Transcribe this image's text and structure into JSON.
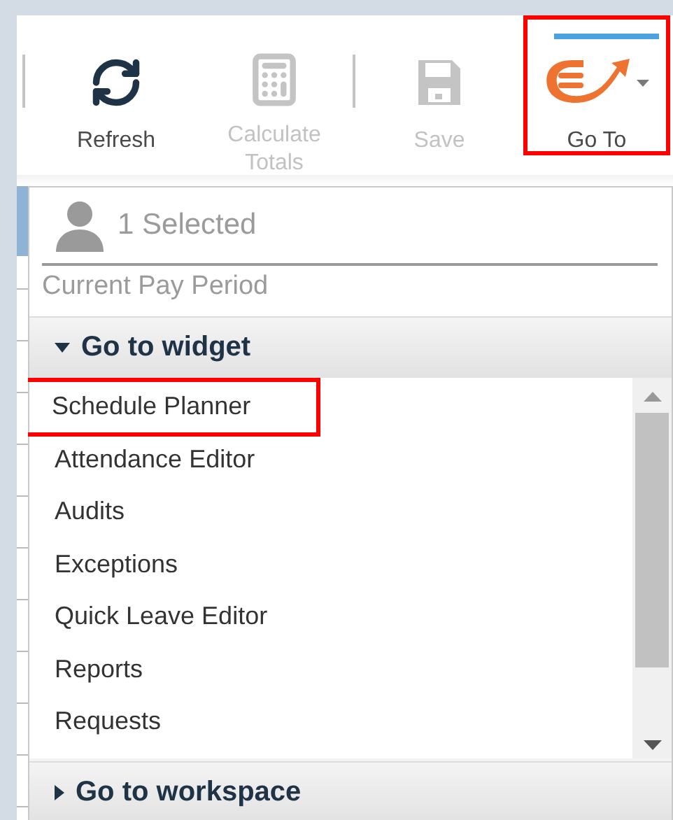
{
  "toolbar": {
    "buttons": [
      {
        "kind": "refresh",
        "label": "Refresh",
        "disabled": false,
        "selected": false,
        "highlighted": false
      },
      {
        "kind": "calculator",
        "label": "Calculate Totals",
        "disabled": true,
        "selected": false,
        "highlighted": false
      },
      {
        "kind": "save",
        "label": "Save",
        "disabled": true,
        "selected": false,
        "highlighted": false
      },
      {
        "kind": "goto",
        "label": "Go To",
        "disabled": false,
        "selected": true,
        "highlighted": true
      }
    ]
  },
  "goto_menu": {
    "selection": "1 Selected",
    "period": "Current Pay Period",
    "sections": [
      {
        "title": "Go to widget",
        "expanded": true,
        "items": [
          {
            "label": "Schedule Planner",
            "highlighted": true
          },
          {
            "label": "Attendance Editor",
            "highlighted": false
          },
          {
            "label": "Audits",
            "highlighted": false
          },
          {
            "label": "Exceptions",
            "highlighted": false
          },
          {
            "label": "Quick Leave Editor",
            "highlighted": false
          },
          {
            "label": "Reports",
            "highlighted": false
          },
          {
            "label": "Requests",
            "highlighted": false
          }
        ]
      },
      {
        "title": "Go to workspace",
        "expanded": false
      }
    ]
  }
}
